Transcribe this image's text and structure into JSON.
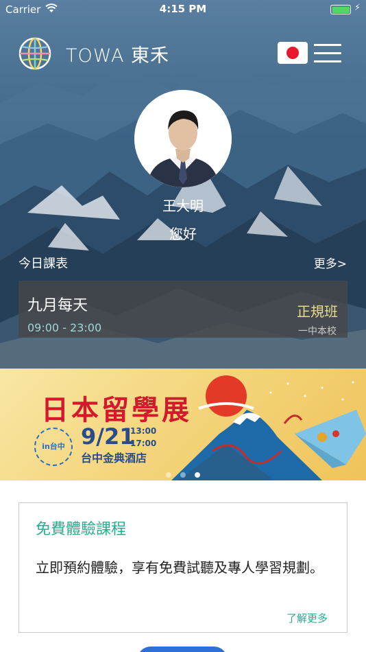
{
  "status_bar": {
    "carrier": "Carrier",
    "time": "4:15 PM",
    "battery_color": "#4cd964"
  },
  "header": {
    "brand_name": "TOWA 東禾",
    "logo_icon": "globe-logo",
    "language_icon": "japan-flag-icon",
    "menu_icon": "hamburger-menu-icon"
  },
  "profile": {
    "name": "王大明",
    "greeting": "您好"
  },
  "schedule": {
    "title": "今日課表",
    "more_label": "更多>",
    "class": {
      "name": "九月每天",
      "time": "09:00 - 23:00",
      "type": "正規班",
      "location": "一中本校"
    }
  },
  "banner": {
    "title": "日本留學展",
    "date": "9/21",
    "time_start": "13:00",
    "time_end": "17:00",
    "venue": "台中金典酒店",
    "badge": "in台中",
    "page_count": 3,
    "active_page": 3
  },
  "trial_card": {
    "title": "免費體驗課程",
    "description": "立即預約體驗，享有免費試聽及專人學習規劃。",
    "more_label": "了解更多"
  },
  "colors": {
    "accent_green": "#2eaa8f",
    "class_type_gold": "#eadc8f",
    "class_time_teal": "#9fd6d6",
    "banner_red": "#d4192c",
    "banner_blue": "#2a4c8a",
    "bottom_button": "#2f6fd8"
  }
}
